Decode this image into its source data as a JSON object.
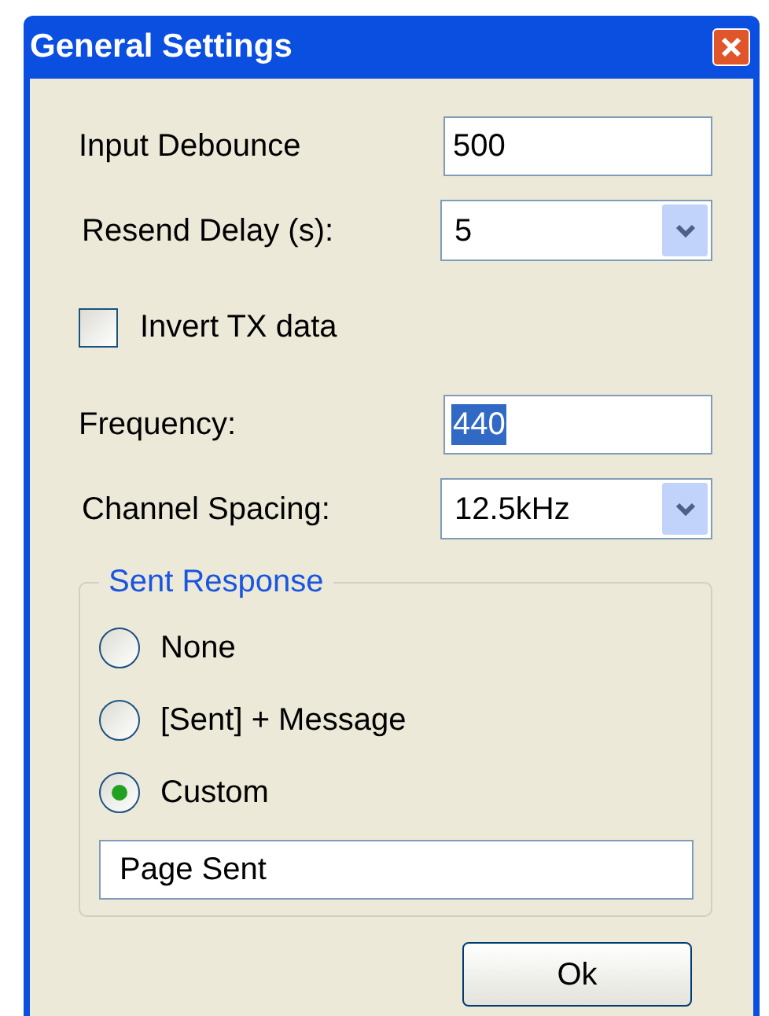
{
  "window": {
    "title": "General Settings"
  },
  "fields": [
    {
      "kind": "text",
      "label": "Input Debounce",
      "value": "500",
      "highlighted": false
    },
    {
      "kind": "select",
      "label": "Resend Delay (s):",
      "value": "5"
    },
    {
      "kind": "checkbox",
      "label": "Invert TX data",
      "checked": false
    },
    {
      "kind": "text",
      "label": "Frequency:",
      "value": "440",
      "highlighted": true
    },
    {
      "kind": "select",
      "label": "Channel Spacing:",
      "value": "12.5kHz"
    }
  ],
  "sent_response": {
    "title": "Sent Response",
    "options": [
      {
        "label": "None",
        "selected": false
      },
      {
        "label": "[Sent] + Message",
        "selected": false
      },
      {
        "label": "Custom",
        "selected": true
      }
    ],
    "custom_text": "Page Sent"
  },
  "buttons": [
    "Ok"
  ]
}
